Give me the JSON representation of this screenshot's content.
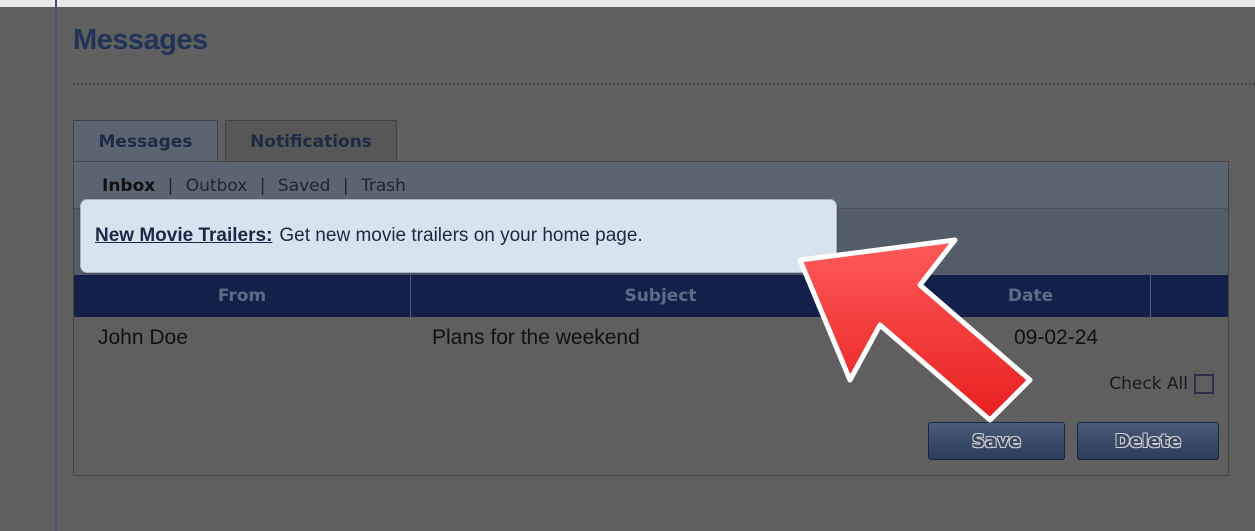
{
  "page": {
    "title": "Messages"
  },
  "tabs": [
    {
      "label": "Messages",
      "active": true
    },
    {
      "label": "Notifications",
      "active": false
    }
  ],
  "subnav": {
    "items": [
      {
        "label": "Inbox",
        "active": true
      },
      {
        "label": "Outbox",
        "active": false
      },
      {
        "label": "Saved",
        "active": false
      },
      {
        "label": "Trash",
        "active": false
      }
    ],
    "separator": "|"
  },
  "table": {
    "columns": [
      "From",
      "Subject",
      "Date"
    ],
    "rows": [
      {
        "from": "John Doe",
        "subject": "Plans for the weekend",
        "date": "09-02-24"
      }
    ]
  },
  "controls": {
    "check_all_label": "Check All",
    "save_label": "Save",
    "delete_label": "Delete"
  },
  "tooltip": {
    "link_text": "New Movie Trailers:",
    "text": "Get new movie trailers on your home page."
  },
  "colors": {
    "arrow": "#ff3b3b",
    "header_bg": "#12204a",
    "tooltip_bg": "#d6e4f0"
  },
  "icons": {
    "arrow": "pointer-arrow-icon",
    "checkbox": "checkbox-icon"
  }
}
